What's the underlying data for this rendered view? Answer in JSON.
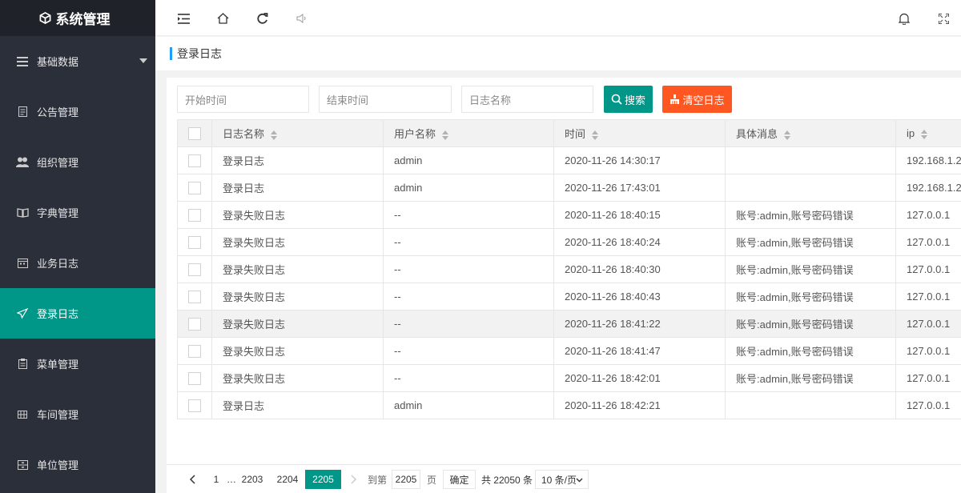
{
  "sidebar": {
    "title": "系统管理",
    "items": [
      {
        "label": "基础数据",
        "icon": "list-icon"
      },
      {
        "label": "公告管理",
        "icon": "document-icon"
      },
      {
        "label": "组织管理",
        "icon": "users-icon"
      },
      {
        "label": "字典管理",
        "icon": "book-icon"
      },
      {
        "label": "业务日志",
        "icon": "calendar-icon"
      },
      {
        "label": "登录日志",
        "icon": "send-icon"
      },
      {
        "label": "菜单管理",
        "icon": "clipboard-icon"
      },
      {
        "label": "车间管理",
        "icon": "grid-icon"
      },
      {
        "label": "单位管理",
        "icon": "storage-icon"
      }
    ],
    "active_index": 5
  },
  "page": {
    "title": "登录日志"
  },
  "filters": {
    "start_placeholder": "开始时间",
    "end_placeholder": "结束时间",
    "name_placeholder": "日志名称",
    "search_label": "搜索",
    "clear_label": "清空日志"
  },
  "table": {
    "columns": [
      "日志名称",
      "用户名称",
      "时间",
      "具体消息",
      "ip"
    ],
    "rows": [
      [
        "登录日志",
        "admin",
        "2020-11-26 14:30:17",
        "",
        "192.168.1.2"
      ],
      [
        "登录日志",
        "admin",
        "2020-11-26 17:43:01",
        "",
        "192.168.1.2"
      ],
      [
        "登录失败日志",
        "--",
        "2020-11-26 18:40:15",
        "账号:admin,账号密码错误",
        "127.0.0.1"
      ],
      [
        "登录失败日志",
        "--",
        "2020-11-26 18:40:24",
        "账号:admin,账号密码错误",
        "127.0.0.1"
      ],
      [
        "登录失败日志",
        "--",
        "2020-11-26 18:40:30",
        "账号:admin,账号密码错误",
        "127.0.0.1"
      ],
      [
        "登录失败日志",
        "--",
        "2020-11-26 18:40:43",
        "账号:admin,账号密码错误",
        "127.0.0.1"
      ],
      [
        "登录失败日志",
        "--",
        "2020-11-26 18:41:22",
        "账号:admin,账号密码错误",
        "127.0.0.1"
      ],
      [
        "登录失败日志",
        "--",
        "2020-11-26 18:41:47",
        "账号:admin,账号密码错误",
        "127.0.0.1"
      ],
      [
        "登录失败日志",
        "--",
        "2020-11-26 18:42:01",
        "账号:admin,账号密码错误",
        "127.0.0.1"
      ],
      [
        "登录日志",
        "admin",
        "2020-11-26 18:42:21",
        "",
        "127.0.0.1"
      ]
    ]
  },
  "pager": {
    "first": "1",
    "ellipsis": "…",
    "p1": "2203",
    "p2": "2204",
    "current": "2205",
    "goto_label": "到第",
    "goto_value": "2205",
    "page_unit": "页",
    "confirm": "确定",
    "total": "共 22050 条",
    "page_size": "10 条/页"
  },
  "colors": {
    "sidebar_bg": "#2b2f3a",
    "accent": "#009688",
    "danger": "#ff5722",
    "title_bar": "#1e9fff"
  }
}
